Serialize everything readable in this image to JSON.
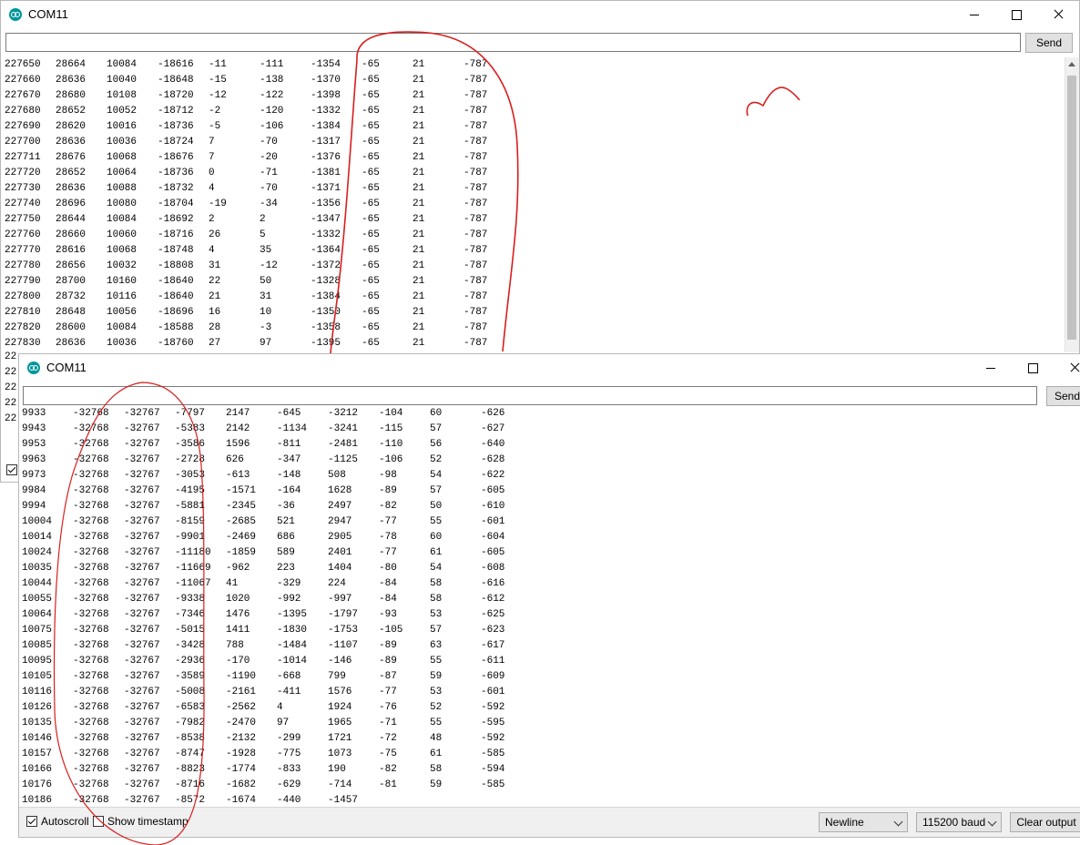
{
  "window_top": {
    "title": "COM11",
    "send_label": "Send",
    "input_value": "",
    "rows": [
      [
        "227650",
        "28664",
        "10084",
        "-18616",
        "-11",
        "-111",
        "-1354",
        "-65",
        "21",
        "-787"
      ],
      [
        "227660",
        "28636",
        "10040",
        "-18648",
        "-15",
        "-138",
        "-1370",
        "-65",
        "21",
        "-787"
      ],
      [
        "227670",
        "28680",
        "10108",
        "-18720",
        "-12",
        "-122",
        "-1398",
        "-65",
        "21",
        "-787"
      ],
      [
        "227680",
        "28652",
        "10052",
        "-18712",
        "-2",
        "-120",
        "-1332",
        "-65",
        "21",
        "-787"
      ],
      [
        "227690",
        "28620",
        "10016",
        "-18736",
        "-5",
        "-106",
        "-1384",
        "-65",
        "21",
        "-787"
      ],
      [
        "227700",
        "28636",
        "10036",
        "-18724",
        "7",
        "-70",
        "-1317",
        "-65",
        "21",
        "-787"
      ],
      [
        "227711",
        "28676",
        "10068",
        "-18676",
        "7",
        "-20",
        "-1376",
        "-65",
        "21",
        "-787"
      ],
      [
        "227720",
        "28652",
        "10064",
        "-18736",
        "0",
        "-71",
        "-1381",
        "-65",
        "21",
        "-787"
      ],
      [
        "227730",
        "28636",
        "10088",
        "-18732",
        "4",
        "-70",
        "-1371",
        "-65",
        "21",
        "-787"
      ],
      [
        "227740",
        "28696",
        "10080",
        "-18704",
        "-19",
        "-34",
        "-1356",
        "-65",
        "21",
        "-787"
      ],
      [
        "227750",
        "28644",
        "10084",
        "-18692",
        "2",
        "2",
        "-1347",
        "-65",
        "21",
        "-787"
      ],
      [
        "227760",
        "28660",
        "10060",
        "-18716",
        "26",
        "5",
        "-1332",
        "-65",
        "21",
        "-787"
      ],
      [
        "227770",
        "28616",
        "10068",
        "-18748",
        "4",
        "35",
        "-1364",
        "-65",
        "21",
        "-787"
      ],
      [
        "227780",
        "28656",
        "10032",
        "-18808",
        "31",
        "-12",
        "-1372",
        "-65",
        "21",
        "-787"
      ],
      [
        "227790",
        "28700",
        "10160",
        "-18640",
        "22",
        "50",
        "-1328",
        "-65",
        "21",
        "-787"
      ],
      [
        "227800",
        "28732",
        "10116",
        "-18640",
        "21",
        "31",
        "-1384",
        "-65",
        "21",
        "-787"
      ],
      [
        "227810",
        "28648",
        "10056",
        "-18696",
        "16",
        "10",
        "-1350",
        "-65",
        "21",
        "-787"
      ],
      [
        "227820",
        "28600",
        "10084",
        "-18588",
        "28",
        "-3",
        "-1358",
        "-65",
        "21",
        "-787"
      ],
      [
        "227830",
        "28636",
        "10036",
        "-18760",
        "27",
        "97",
        "-1395",
        "-65",
        "21",
        "-787"
      ]
    ],
    "hidden_row_starts": [
      "22",
      "22",
      "22",
      "22",
      "22"
    ]
  },
  "window_bottom": {
    "title": "COM11",
    "send_label": "Send",
    "input_value": "",
    "rows": [
      [
        "9933",
        "-32768",
        "-32767",
        "-7797",
        "2147",
        "-645",
        "-3212",
        "-104",
        "60",
        "-626"
      ],
      [
        "9943",
        "-32768",
        "-32767",
        "-5383",
        "2142",
        "-1134",
        "-3241",
        "-115",
        "57",
        "-627"
      ],
      [
        "9953",
        "-32768",
        "-32767",
        "-3586",
        "1596",
        "-811",
        "-2481",
        "-110",
        "56",
        "-640"
      ],
      [
        "9963",
        "-32768",
        "-32767",
        "-2728",
        "626",
        "-347",
        "-1125",
        "-106",
        "52",
        "-628"
      ],
      [
        "9973",
        "-32768",
        "-32767",
        "-3053",
        "-613",
        "-148",
        "508",
        "-98",
        "54",
        "-622"
      ],
      [
        "9984",
        "-32768",
        "-32767",
        "-4195",
        "-1571",
        "-164",
        "1628",
        "-89",
        "57",
        "-605"
      ],
      [
        "9994",
        "-32768",
        "-32767",
        "-5881",
        "-2345",
        "-36",
        "2497",
        "-82",
        "50",
        "-610"
      ],
      [
        "10004",
        "-32768",
        "-32767",
        "-8159",
        "-2685",
        "521",
        "2947",
        "-77",
        "55",
        "-601"
      ],
      [
        "10014",
        "-32768",
        "-32767",
        "-9901",
        "-2469",
        "686",
        "2905",
        "-78",
        "60",
        "-604"
      ],
      [
        "10024",
        "-32768",
        "-32767",
        "-11180",
        "-1859",
        "589",
        "2401",
        "-77",
        "61",
        "-605"
      ],
      [
        "10035",
        "-32768",
        "-32767",
        "-11669",
        "-962",
        "223",
        "1404",
        "-80",
        "54",
        "-608"
      ],
      [
        "10044",
        "-32768",
        "-32767",
        "-11067",
        "41",
        "-329",
        "224",
        "-84",
        "58",
        "-616"
      ],
      [
        "10055",
        "-32768",
        "-32767",
        "-9338",
        "1020",
        "-992",
        "-997",
        "-84",
        "58",
        "-612"
      ],
      [
        "10064",
        "-32768",
        "-32767",
        "-7346",
        "1476",
        "-1395",
        "-1797",
        "-93",
        "53",
        "-625"
      ],
      [
        "10075",
        "-32768",
        "-32767",
        "-5015",
        "1411",
        "-1830",
        "-1753",
        "-105",
        "57",
        "-623"
      ],
      [
        "10085",
        "-32768",
        "-32767",
        "-3428",
        "788",
        "-1484",
        "-1107",
        "-89",
        "63",
        "-617"
      ],
      [
        "10095",
        "-32768",
        "-32767",
        "-2936",
        "-170",
        "-1014",
        "-146",
        "-89",
        "55",
        "-611"
      ],
      [
        "10105",
        "-32768",
        "-32767",
        "-3589",
        "-1190",
        "-668",
        "799",
        "-87",
        "59",
        "-609"
      ],
      [
        "10116",
        "-32768",
        "-32767",
        "-5008",
        "-2161",
        "-411",
        "1576",
        "-77",
        "53",
        "-601"
      ],
      [
        "10126",
        "-32768",
        "-32767",
        "-6583",
        "-2562",
        "4",
        "1924",
        "-76",
        "52",
        "-592"
      ],
      [
        "10135",
        "-32768",
        "-32767",
        "-7982",
        "-2470",
        "97",
        "1965",
        "-71",
        "55",
        "-595"
      ],
      [
        "10146",
        "-32768",
        "-32767",
        "-8538",
        "-2132",
        "-299",
        "1721",
        "-72",
        "48",
        "-592"
      ],
      [
        "10157",
        "-32768",
        "-32767",
        "-8747",
        "-1928",
        "-775",
        "1073",
        "-75",
        "61",
        "-585"
      ],
      [
        "10166",
        "-32768",
        "-32767",
        "-8823",
        "-1774",
        "-833",
        "190",
        "-82",
        "58",
        "-594"
      ],
      [
        "10176",
        "-32768",
        "-32767",
        "-8716",
        "-1682",
        "-629",
        "-714",
        "-81",
        "59",
        "-585"
      ],
      [
        "10186",
        "-32768",
        "-32767",
        "-8572",
        "-1674",
        "-440",
        "-1457"
      ]
    ],
    "autoscroll_label": "Autoscroll",
    "autoscroll_checked": true,
    "timestamp_label": "Show timestamp",
    "timestamp_checked": false,
    "line_ending": "Newline",
    "baud": "115200 baud",
    "clear_label": "Clear output"
  },
  "annotation_color": "#d81e1e",
  "icons": [
    "arduino-logo-icon",
    "minimize-icon",
    "maximize-icon",
    "close-icon",
    "chevron-down-icon",
    "checkbox-icon"
  ]
}
